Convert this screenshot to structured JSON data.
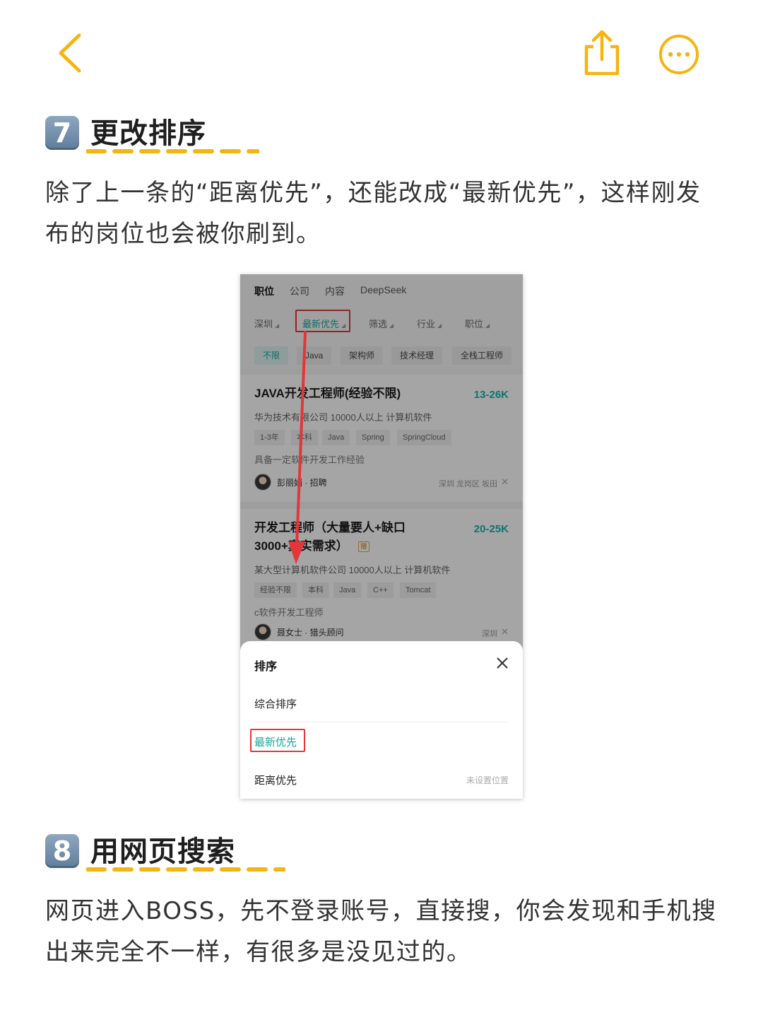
{
  "topbar": {
    "back_icon": "chevron-left-icon",
    "share_icon": "share-icon",
    "more_icon": "more-icon",
    "accent_color": "#f5b50e"
  },
  "section7": {
    "number": "7",
    "title": "更改排序",
    "text": "除了上一条的“距离优先”，还能改成“最新优先”，这样刚发布的岗位也会被你刷到。"
  },
  "screenshot": {
    "nav_tabs": [
      "职位",
      "公司",
      "内容",
      "DeepSeek"
    ],
    "filters": [
      "深圳",
      "最新优先",
      "筛选",
      "行业",
      "职位"
    ],
    "chips": [
      "不限",
      "Java",
      "架构师",
      "技术经理",
      "全栈工程师"
    ],
    "jobs": [
      {
        "title": "JAVA开发工程师(经验不限)",
        "salary": "13-26K",
        "company": "华为技术有限公司 10000人以上 计算机软件",
        "tags": [
          "1-3年",
          "本科",
          "Java",
          "Spring",
          "SpringCloud"
        ],
        "desc": "具备一定软件开发工作经验",
        "recruiter": "彭丽娟 · 招聘",
        "location": "深圳 龙岗区 坂田"
      },
      {
        "title_line1": "开发工程师（大量要人+缺口",
        "title_line2": "3000+真实需求）",
        "badge": "猎",
        "salary": "20-25K",
        "company": "某大型计算机软件公司 10000人以上 计算机软件",
        "tags": [
          "经验不限",
          "本科",
          "Java",
          "C++",
          "Tomcat"
        ],
        "desc": "c软件开发工程师",
        "recruiter": "聂女士 · 猎头顾问",
        "location": "深圳"
      }
    ],
    "sheet": {
      "title": "排序",
      "options": [
        "综合排序",
        "最新优先",
        "距离优先"
      ],
      "hint": "未设置位置"
    },
    "accent_color": "#1aa59c",
    "highlight_color": "#e2363a"
  },
  "section8": {
    "number": "8",
    "title": "用网页搜索",
    "text": "网页进入BOSS，先不登录账号，直接搜，你会发现和手机搜出来完全不一样，有很多是没见过的。"
  }
}
